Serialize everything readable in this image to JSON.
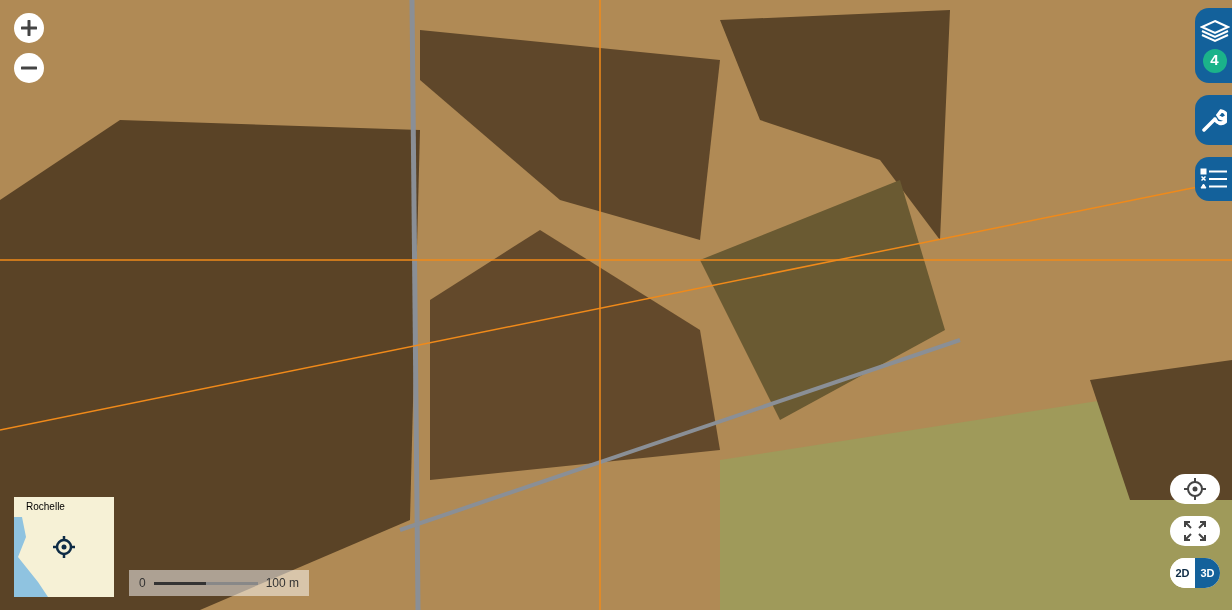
{
  "layers_button": {
    "badge": "4"
  },
  "minimap": {
    "label": "Rochelle"
  },
  "scale_bar": {
    "start": "0",
    "end": "100 m",
    "level": 0.5
  },
  "view_mode": [
    {
      "label": "2D",
      "selected": false
    },
    {
      "label": "3D",
      "selected": true
    }
  ]
}
